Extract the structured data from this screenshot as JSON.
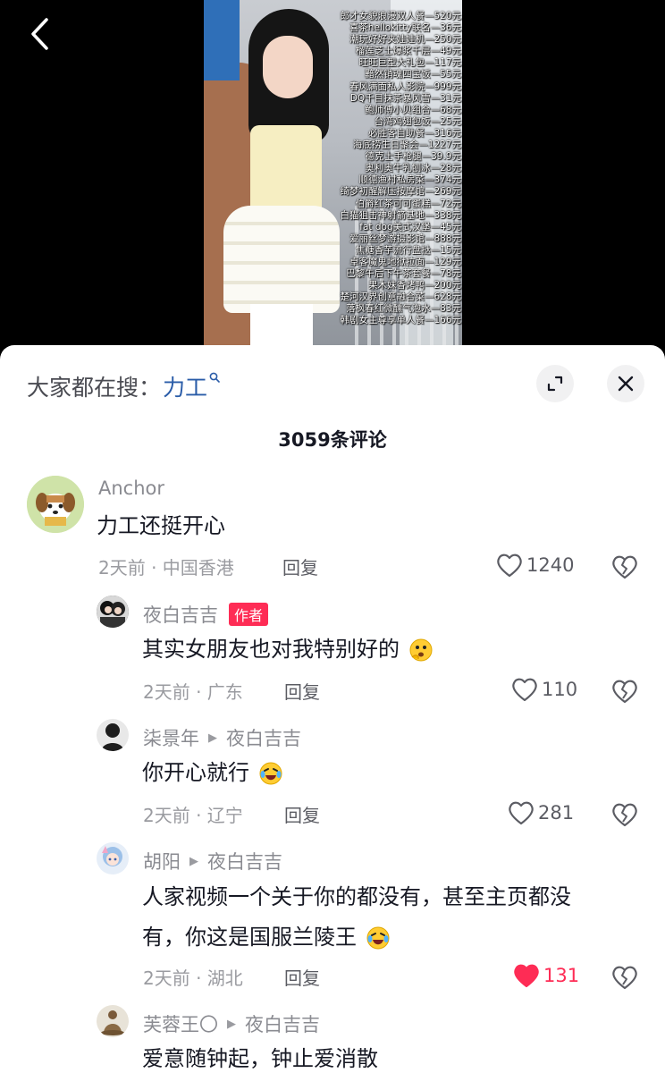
{
  "video": {
    "price_list": [
      "郎才女貌浪漫双人餐—520元",
      "喜茶hellokitty联名—36元",
      "潮玩好好夹娃娃机—250元",
      "榴莲芝士爆浆千层—49元",
      "旺旺巨型大礼包—117元",
      "黯然销魂四宝饭—55元",
      "春风满面私人影院—999元",
      "DQ千目抹茶暴风雪—31元",
      "鲍师傅小贝组合—68元",
      "台湾鸡翅包饭—25元",
      "必胜客自助餐—316元",
      "海底捞生日聚会—1227元",
      "德克士手枪腿—39.9元",
      "奥利奥牛乳刨冰—28元",
      "顺德渔村私房菜—374元",
      "绮梦初醒解压按摩馆—269元",
      "伯爵红茶可可蛋糕—72元",
      "白猫狙击神射箭基地—338元",
      "fat dog美式汉堡—45元",
      "爱丽丝梦游摄影馆—888元",
      "焦糖香芋流行盘挞—15元",
      "卓客魔鬼地狱拉面—129元",
      "巴黎午后下午茶套餐—78元",
      "果木妹香烤鸭—200元",
      "楚河汉界创意融合菜—628元",
      "落枫春红微醺气泡水—83元",
      "韩剧女主尊享单人餐—166元"
    ]
  },
  "sheet": {
    "search_prefix": "大家都在搜：",
    "search_term": "力工",
    "comment_count": "3059条评论"
  },
  "comments": [
    {
      "name": "Anchor",
      "text": "力工还挺开心",
      "meta": "2天前 · 中国香港",
      "reply": "回复",
      "likes": "1240"
    },
    {
      "name": "夜白吉吉",
      "badge": "作者",
      "text": "其实女朋友也对我特别好的",
      "meta": "2天前 · 广东",
      "reply": "回复",
      "likes": "110"
    },
    {
      "name": "柒景年",
      "reply_to": "夜白吉吉",
      "text": "你开心就行",
      "meta": "2天前 · 辽宁",
      "reply": "回复",
      "likes": "281"
    },
    {
      "name": "胡阳",
      "reply_to": "夜白吉吉",
      "text_line1": "人家视频一个关于你的都没有，甚至主页都没",
      "text_line2": "有，你这是国服兰陵王",
      "meta": "2天前 · 湖北",
      "reply": "回复",
      "likes": "131",
      "liked": true
    },
    {
      "name": "芙蓉王〇",
      "reply_to": "夜白吉吉",
      "text": "爱意随钟起，钟止爱消散"
    }
  ],
  "colors": {
    "accent": "#fe2c55",
    "search_term": "#2a5ca8"
  }
}
